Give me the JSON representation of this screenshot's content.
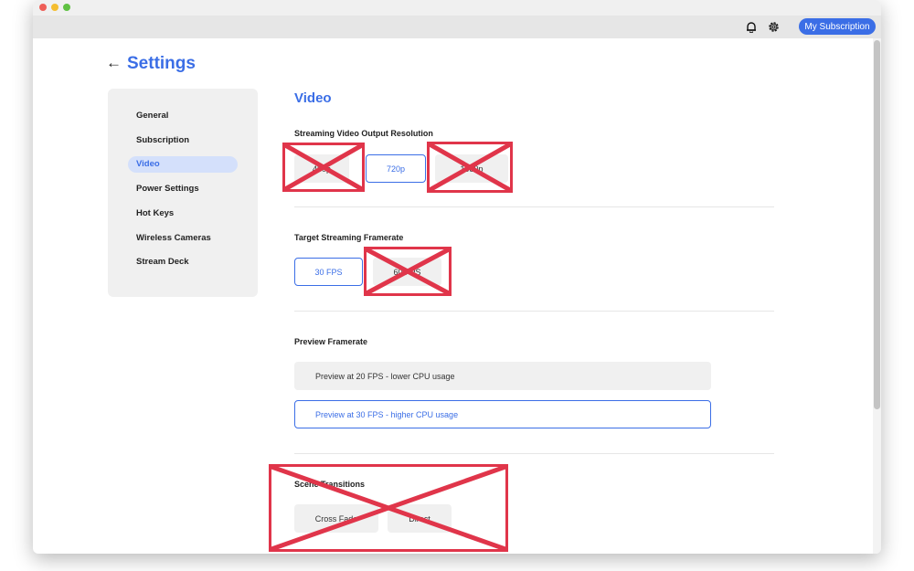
{
  "toolbar": {
    "icons": [
      "bell-icon",
      "gear-icon"
    ],
    "subscription_button": "My Subscription"
  },
  "page": {
    "back_icon": "←",
    "title": "Settings"
  },
  "sidebar": {
    "items": [
      {
        "label": "General"
      },
      {
        "label": "Subscription"
      },
      {
        "label": "Video",
        "active": true
      },
      {
        "label": "Power Settings"
      },
      {
        "label": "Hot Keys"
      },
      {
        "label": "Wireless Cameras"
      },
      {
        "label": "Stream Deck"
      }
    ]
  },
  "content": {
    "section_title": "Video",
    "resolution": {
      "label": "Streaming Video Output Resolution",
      "options": [
        {
          "label": "480p",
          "selected": false
        },
        {
          "label": "720p",
          "selected": true
        },
        {
          "label": "1080p",
          "selected": false
        }
      ]
    },
    "framerate": {
      "label": "Target Streaming Framerate",
      "options": [
        {
          "label": "30 FPS",
          "selected": true
        },
        {
          "label": "60 FPS",
          "selected": false
        }
      ]
    },
    "preview": {
      "label": "Preview Framerate",
      "options": [
        {
          "label": "Preview at 20 FPS - lower CPU usage",
          "selected": false
        },
        {
          "label": "Preview at 30 FPS - higher CPU usage",
          "selected": true
        }
      ]
    },
    "transitions": {
      "label": "Scene Transitions",
      "options": [
        {
          "label": "Cross Fade",
          "selected": false
        },
        {
          "label": "Direct",
          "selected": false
        }
      ]
    }
  },
  "colors": {
    "accent": "#3b6ee6",
    "annotation_cross": "#e0354a",
    "active_nav_bg": "#d4e0fb"
  }
}
